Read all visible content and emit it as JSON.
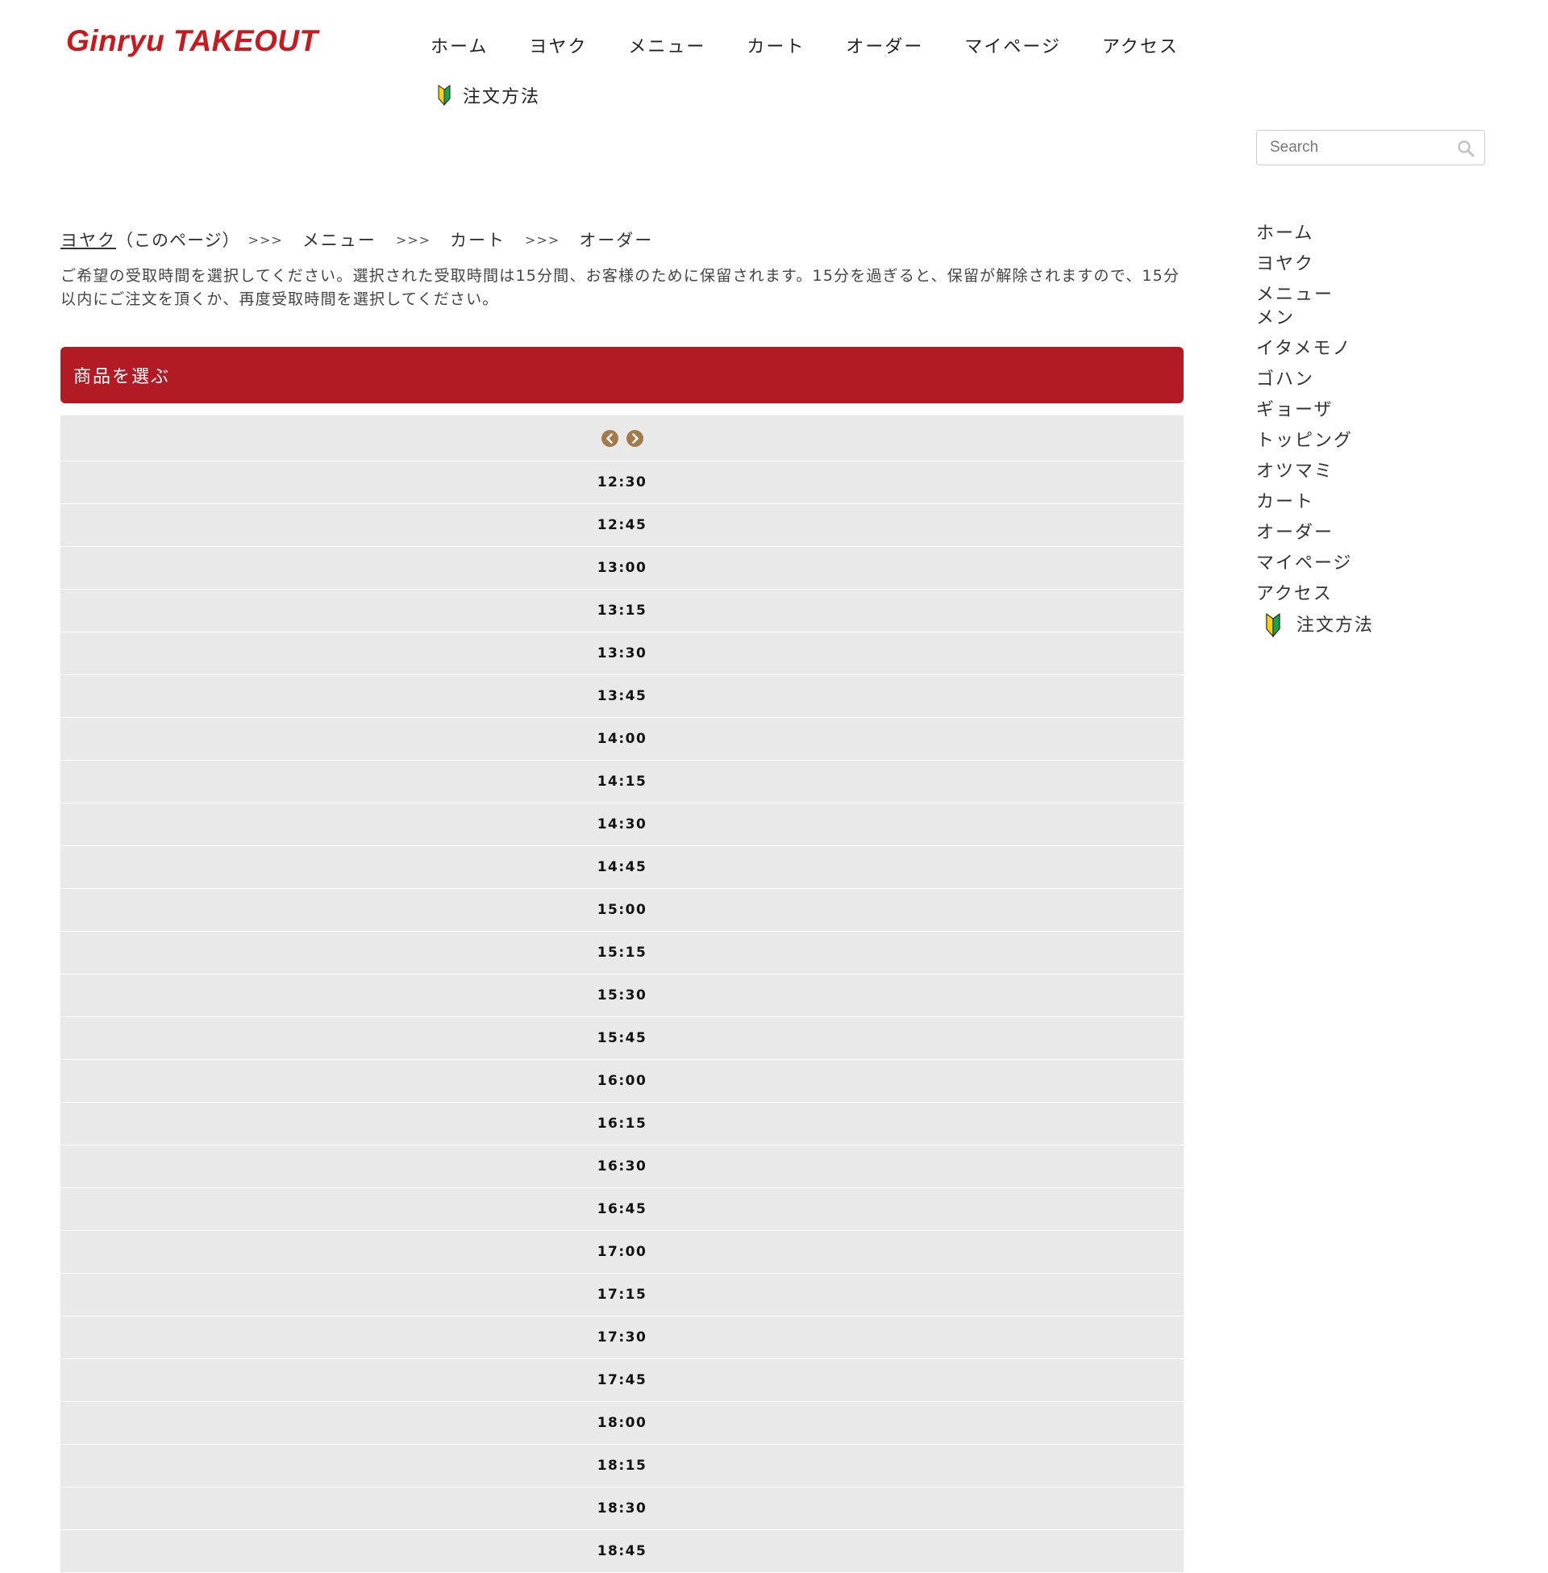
{
  "site": {
    "logo_text": "Ginryu TAKEOUT"
  },
  "nav": {
    "items": [
      {
        "label": "ホーム"
      },
      {
        "label": "ヨヤク"
      },
      {
        "label": "メニュー"
      },
      {
        "label": "カート"
      },
      {
        "label": "オーダー"
      },
      {
        "label": "マイページ"
      },
      {
        "label": "アクセス"
      }
    ],
    "guide_label": "注文方法"
  },
  "search": {
    "placeholder": "Search"
  },
  "sidebar": {
    "items": [
      {
        "label": "ホーム"
      },
      {
        "label": "ヨヤク"
      },
      {
        "label": "メニュー"
      },
      {
        "label": "メン"
      },
      {
        "label": "イタメモノ"
      },
      {
        "label": "ゴハン"
      },
      {
        "label": "ギョーザ"
      },
      {
        "label": "トッピング"
      },
      {
        "label": "オツマミ"
      },
      {
        "label": "カート"
      },
      {
        "label": "オーダー"
      },
      {
        "label": "マイページ"
      },
      {
        "label": "アクセス"
      }
    ],
    "guide_label": "注文方法"
  },
  "breadcrumb": {
    "current_link": "ヨヤク",
    "current_note": "（このページ）",
    "separator": ">>>",
    "steps": [
      "メニュー",
      "カート",
      "オーダー"
    ]
  },
  "instructions": "ご希望の受取時間を選択してください。選択された受取時間は15分間、お客様のために保留されます。15分を過ぎると、保留が解除されますので、15分以内にご注文を頂くか、再度受取時間を選択してください。",
  "section": {
    "title": "商品を選ぶ"
  },
  "timetable": {
    "times": [
      "12:30",
      "12:45",
      "13:00",
      "13:15",
      "13:30",
      "13:45",
      "14:00",
      "14:15",
      "14:30",
      "14:45",
      "15:00",
      "15:15",
      "15:30",
      "15:45",
      "16:00",
      "16:15",
      "16:30",
      "16:45",
      "17:00",
      "17:15",
      "17:30",
      "17:45",
      "18:00",
      "18:15",
      "18:30",
      "18:45"
    ]
  },
  "colors": {
    "brand_red": "#c8191f",
    "header_red": "#b31b24",
    "arrow_brown": "#a37a4a",
    "table_bg": "#e9e9e9"
  },
  "icons": {
    "beginner": "beginner-mark-icon",
    "search": "search-icon",
    "prev": "chevron-left-circle-icon",
    "next": "chevron-right-circle-icon"
  }
}
